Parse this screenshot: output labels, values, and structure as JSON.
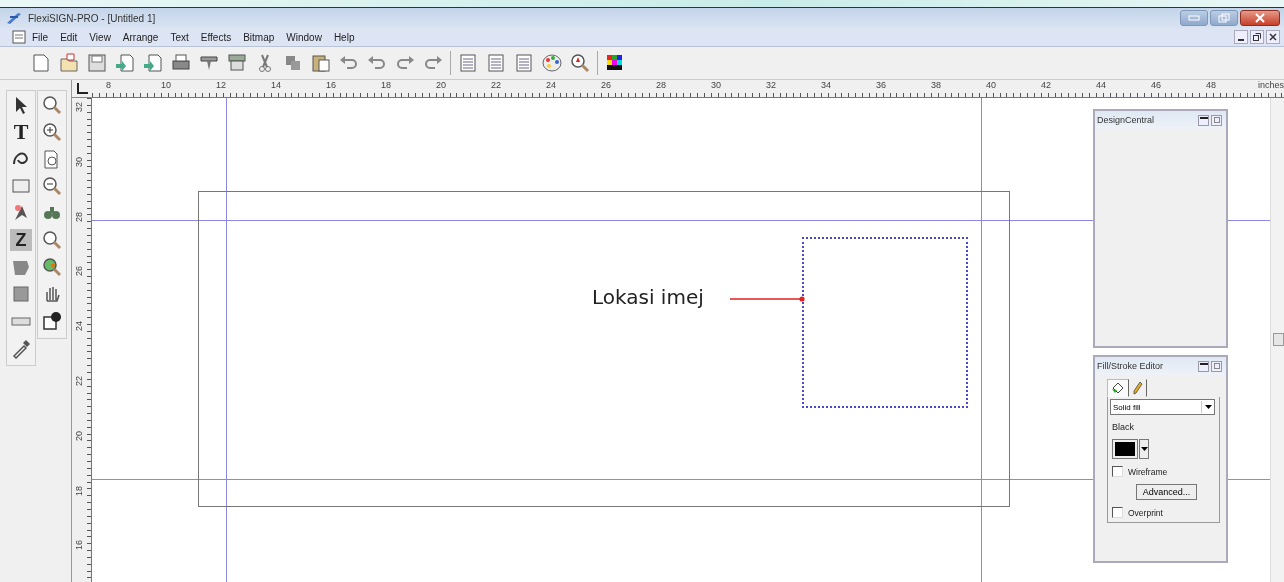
{
  "window": {
    "title": "FlexiSIGN-PRO - [Untitled 1]"
  },
  "menu": [
    "File",
    "Edit",
    "View",
    "Arrange",
    "Text",
    "Effects",
    "Bitmap",
    "Window",
    "Help"
  ],
  "toolbox_glyphs": {
    "text_tool": "T",
    "z_tool": "Z"
  },
  "ruler_horizontal": {
    "labels": [
      "8",
      "10",
      "12",
      "14",
      "16",
      "18",
      "20",
      "22",
      "24",
      "26",
      "28",
      "30",
      "32",
      "34",
      "36",
      "38",
      "40",
      "42",
      "44",
      "46",
      "48"
    ],
    "unit": "inches"
  },
  "ruler_vertical": {
    "labels": [
      "32",
      "30",
      "28",
      "26",
      "24",
      "22",
      "20",
      "18",
      "16"
    ]
  },
  "canvas": {
    "annotation": "Lokasi imej"
  },
  "design_central": {
    "title": "DesignCentral"
  },
  "fill_stroke_editor": {
    "title": "Fill/Stroke Editor",
    "tabs": [
      {
        "kind": "fill",
        "selected": true
      },
      {
        "kind": "stroke",
        "selected": false
      }
    ],
    "fill_type": "Solid fill",
    "color_name": "Black",
    "color": "#000000",
    "options": [
      {
        "label": "Wireframe",
        "checked": false
      },
      {
        "label": "Overprint",
        "checked": false
      }
    ],
    "advanced_button": "Advanced..."
  }
}
